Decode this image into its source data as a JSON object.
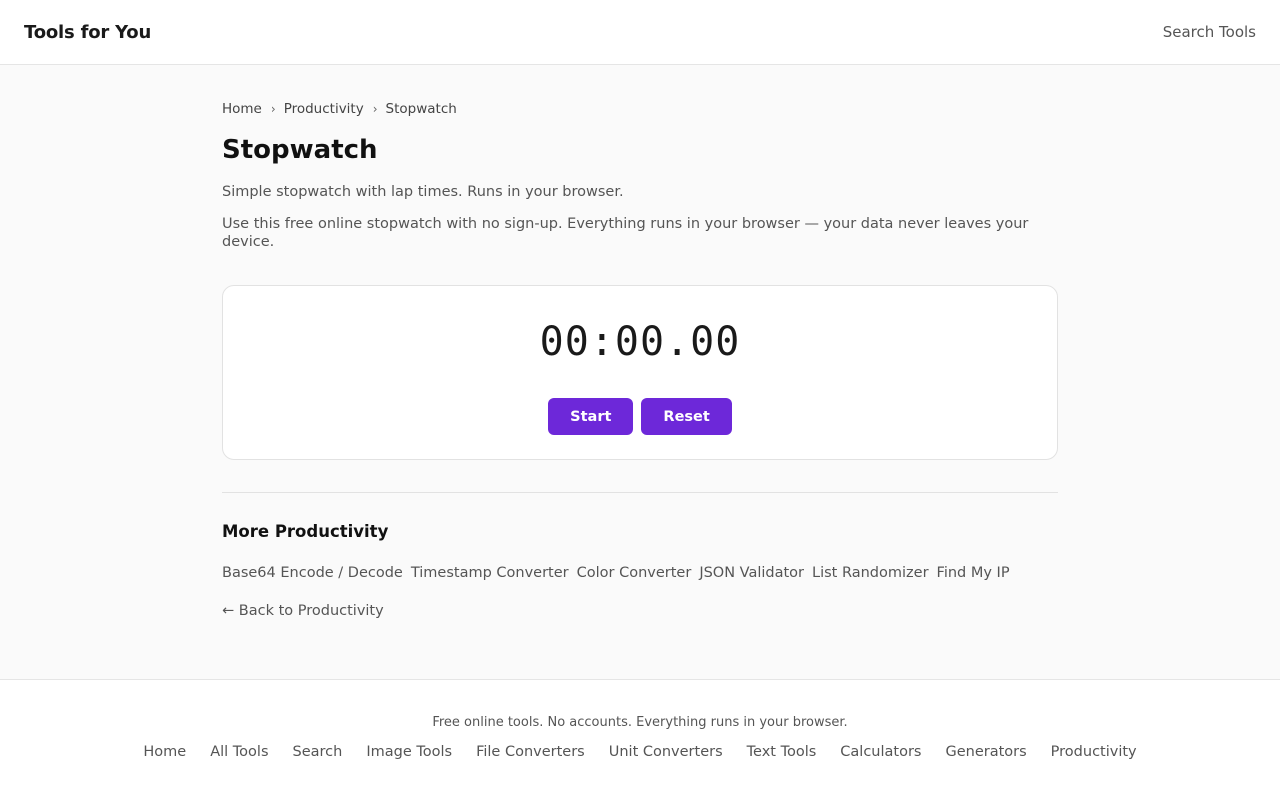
{
  "header": {
    "brand": "Tools for You",
    "search_label": "Search Tools"
  },
  "breadcrumb": [
    {
      "label": "Home"
    },
    {
      "label": "Productivity"
    },
    {
      "label": "Stopwatch"
    }
  ],
  "breadcrumb_separator": "›",
  "page": {
    "title": "Stopwatch",
    "subtitle": "Simple stopwatch with lap times. Runs in your browser.",
    "intro": "Use this free online stopwatch with no sign-up. Everything runs in your browser — your data never leaves your device."
  },
  "stopwatch": {
    "display": "00:00.00",
    "start_label": "Start",
    "reset_label": "Reset"
  },
  "more": {
    "title": "More Productivity",
    "links": [
      "Base64 Encode / Decode",
      "Timestamp Converter",
      "Color Converter",
      "JSON Validator",
      "List Randomizer",
      "Find My IP"
    ],
    "back_label": "← Back to Productivity"
  },
  "footer": {
    "text": "Free online tools. No accounts. Everything runs in your browser.",
    "nav": [
      "Home",
      "All Tools",
      "Search",
      "Image Tools",
      "File Converters",
      "Unit Converters",
      "Text Tools",
      "Calculators",
      "Generators",
      "Productivity"
    ]
  },
  "colors": {
    "accent": "#6d28d9",
    "page_bg": "#fafafa",
    "surface": "#ffffff",
    "border": "#e2e2e2",
    "text_muted": "#555555"
  }
}
